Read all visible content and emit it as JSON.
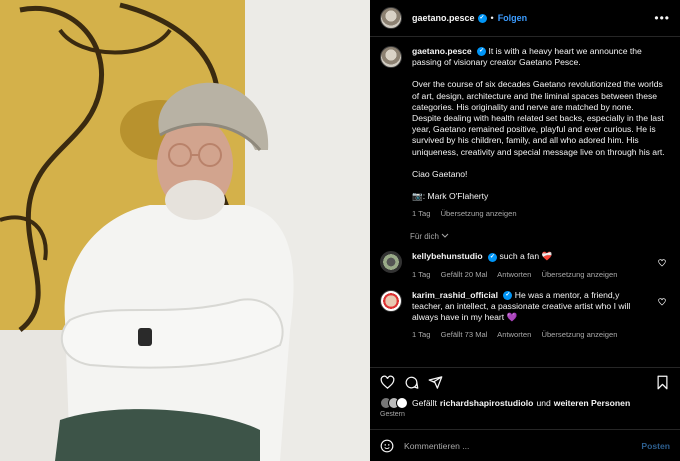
{
  "header": {
    "username": "gaetano.pesce",
    "separator": "•",
    "follow_label": "Folgen",
    "more_label": "•••"
  },
  "caption": {
    "username": "gaetano.pesce",
    "intro": "It is with a heavy heart we announce the passing of visionary creator Gaetano Pesce.",
    "paragraph": "Over the course of six decades Gaetano revolutionized the worlds of art, design, architecture and the liminal spaces between these categories. His originality and nerve are matched by none.\nDespite dealing with health related set backs, especially in the last year, Gaetano remained positive, playful and ever curious. He is survived by his children, family, and all who adored him. His uniqueness, creativity and special message live on through his art.",
    "closing": "Ciao Gaetano!",
    "credit": "📷: Mark O'Flaherty",
    "time": "1 Tag",
    "translate": "Übersetzung anzeigen"
  },
  "see_all": "Für dich",
  "comments": [
    {
      "username": "kellybehunstudio",
      "text": "such a fan ❤️‍🩹",
      "time": "1 Tag",
      "likes": "Gefällt 20 Mal",
      "reply": "Antworten",
      "translate": "Übersetzung anzeigen"
    },
    {
      "username": "karim_rashid_official",
      "text": "He was a mentor, a friend,y teacher, an intellect, a passionate creative artist who I will always have in my heart 💜",
      "time": "1 Tag",
      "likes": "Gefällt 73 Mal",
      "reply": "Antworten",
      "translate": "Übersetzung anzeigen"
    }
  ],
  "likes_line": {
    "prefix": "Gefällt",
    "user": "richardshapirostudiolo",
    "middle": "und",
    "others": "weiteren Personen"
  },
  "posted": "Gestern",
  "comment_input": {
    "placeholder": "Kommentieren ...",
    "post_label": "Posten"
  },
  "colors": {
    "accent": "#0095f6",
    "link": "#3b9cff",
    "muted": "#a8a8a8",
    "background": "#000000"
  },
  "icons": [
    "more-icon",
    "verified-icon",
    "heart-icon",
    "comment-icon",
    "share-icon",
    "bookmark-icon",
    "emoji-icon",
    "chevron-down-icon"
  ]
}
